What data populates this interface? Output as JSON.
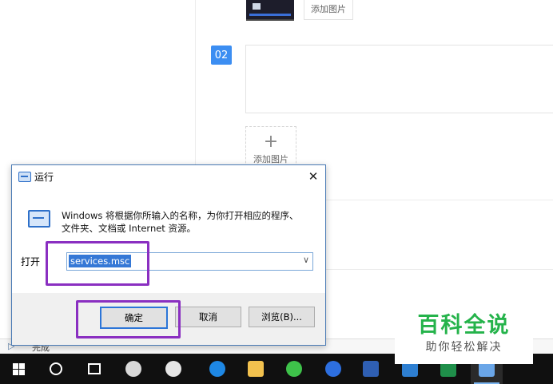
{
  "editor": {
    "add_image_small": "添加图片",
    "step_number": "02",
    "add_plus": "+",
    "add_image_big": "添加图片"
  },
  "status_bar": {
    "text": "完成"
  },
  "run_dialog": {
    "title": "运行",
    "close_glyph": "✕",
    "description": "Windows 将根据你所输入的名称，为你打开相应的程序、文件夹、文档或 Internet 资源。",
    "open_label": "打开",
    "input_value": "services.msc",
    "dropdown_glyph": "∨",
    "buttons": {
      "ok": "确定",
      "cancel": "取消",
      "browse": "浏览(B)..."
    }
  },
  "taskbar": {
    "items": [
      {
        "icon": "windows-start-icon"
      },
      {
        "icon": "search-icon"
      },
      {
        "icon": "task-view-icon"
      },
      {
        "icon": "pinwheel-app-icon",
        "color": "#d9d9d9"
      },
      {
        "icon": "edge-legacy-icon",
        "color": "#e6e6e6"
      },
      {
        "icon": "edge-icon",
        "color": "#1e88e5"
      },
      {
        "icon": "file-explorer-icon",
        "color": "#f2c14e"
      },
      {
        "icon": "ie-green-icon",
        "color": "#3ec24a"
      },
      {
        "icon": "sogou-browser-icon",
        "color": "#2d6fe0"
      },
      {
        "icon": "word-icon",
        "color": "#2f5fb3"
      },
      {
        "icon": "tool-icon",
        "color": "#2e7fd1"
      },
      {
        "icon": "excel-icon",
        "color": "#1f8f4a"
      },
      {
        "icon": "run-icon",
        "color": "#6aa6e8"
      }
    ]
  },
  "watermark": {
    "title": "百科全说",
    "subtitle": "助你轻松解决"
  },
  "colors": {
    "highlight": "#8a2fc1",
    "accent": "#3c8ef2",
    "watermark_green": "#25b34b"
  }
}
